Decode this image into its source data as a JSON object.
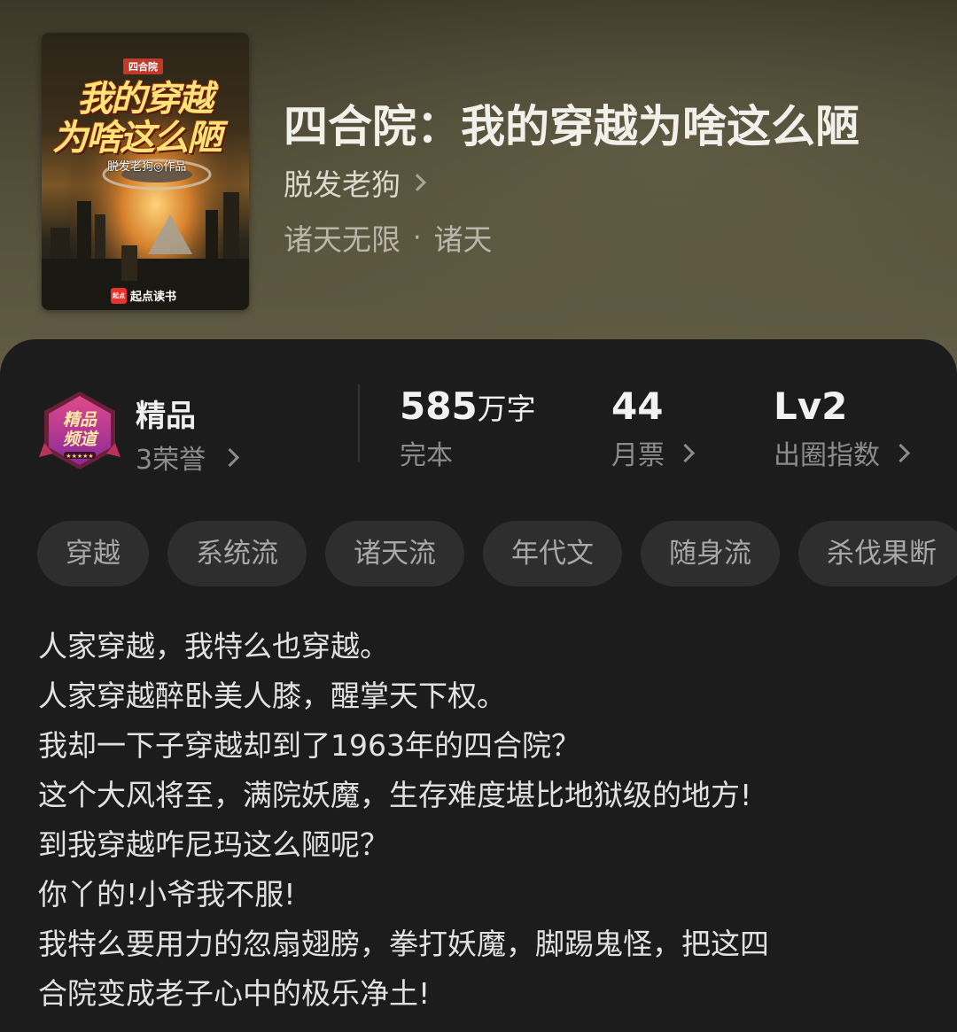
{
  "book": {
    "title": "四合院：我的穿越为啥这么陋",
    "author": "脱发老狗",
    "category_main": "诸天无限",
    "category_separator": "·",
    "category_sub": "诸天"
  },
  "cover": {
    "series": "四合院",
    "title_line1": "我的穿越",
    "title_line2": "为啥这么陋",
    "author_text": "脱发老狗◎作品",
    "brand_badge": "起点",
    "brand": "起点读书"
  },
  "medal": {
    "line1": "精品",
    "line2": "频道"
  },
  "honor": {
    "title": "精品",
    "subtitle": "3荣誉"
  },
  "stats": {
    "words_value": "585",
    "words_unit": "万字",
    "words_label": "完本",
    "votes_value": "44",
    "votes_label": "月票",
    "index_value": "Lv2",
    "index_label": "出圈指数"
  },
  "tags": [
    "穿越",
    "系统流",
    "诸天流",
    "年代文",
    "随身流",
    "杀伐果断"
  ],
  "description": [
    "人家穿越，我特么也穿越。",
    "人家穿越醉卧美人膝，醒掌天下权。",
    "我却一下子穿越却到了1963年的四合院？",
    "这个大风将至，满院妖魔，生存难度堪比地狱级的地方!",
    "到我穿越咋尼玛这么陋呢？",
    "你丫的!小爷我不服!",
    "我特么要用力的忽扇翅膀，拳打妖魔，脚踢鬼怪，把这四",
    "合院变成老子心中的极乐净土!"
  ],
  "colors": {
    "panel": "#1c1c1c",
    "tag_bg": "#2e2e2e",
    "header_bg": "#4a4635"
  }
}
